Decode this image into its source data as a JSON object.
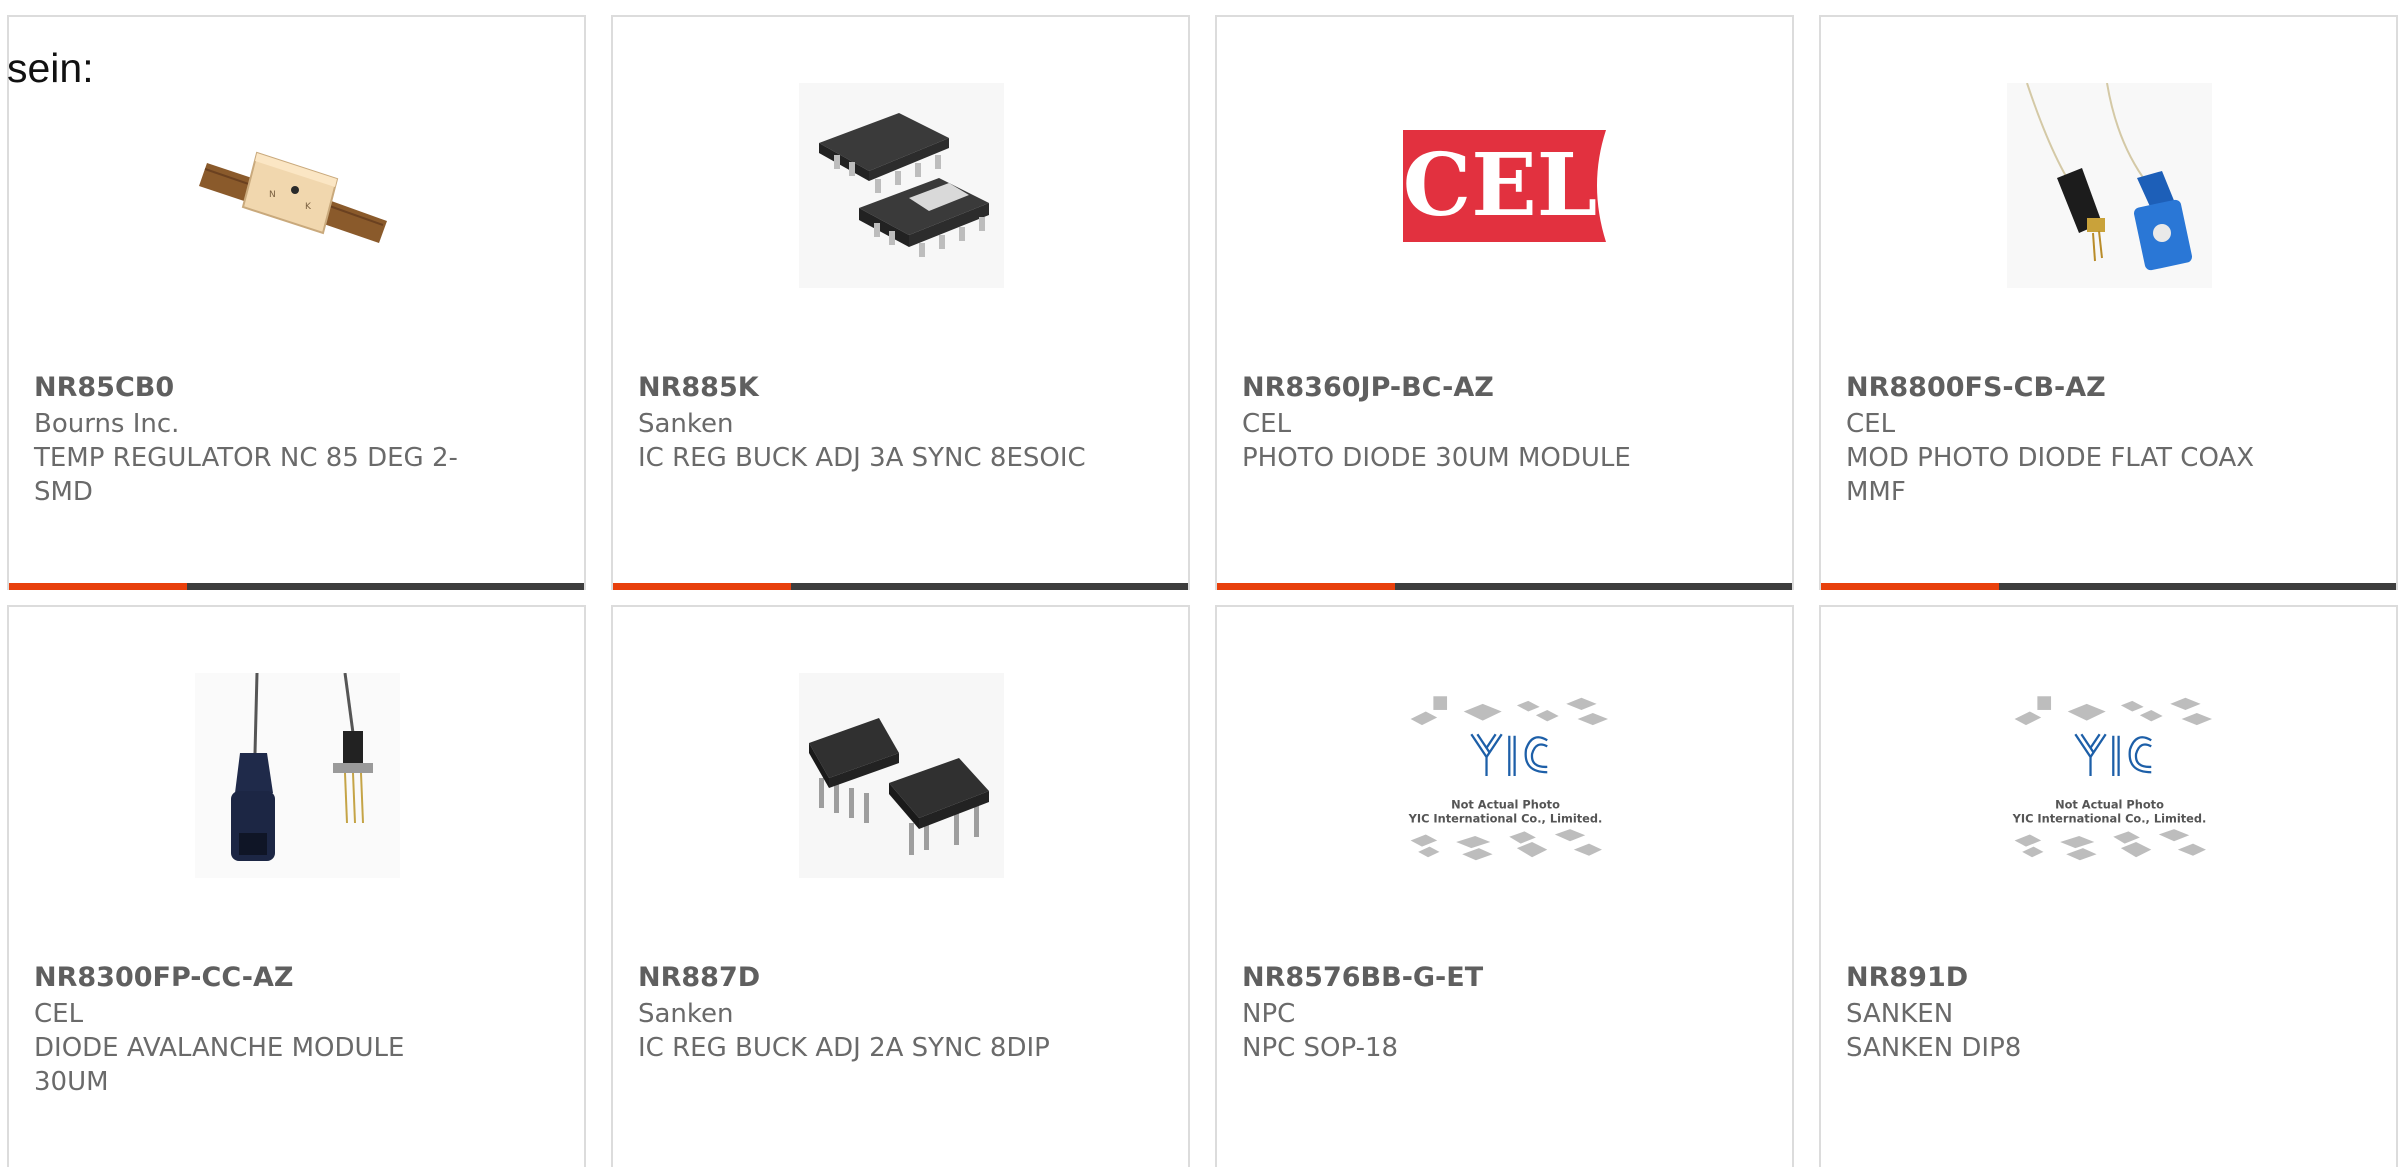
{
  "page": {
    "heading": "sein:"
  },
  "colors": {
    "accent": "#e8400c",
    "bar": "#3d3d3d",
    "card_border": "#dcdcdc",
    "text": "#5f5f5f"
  },
  "cards": [
    {
      "part_number": "NR85CB0",
      "manufacturer": "Bourns Inc.",
      "description": "TEMP REGULATOR NC 85 DEG 2-SMD",
      "image": "temp-regulator-photo",
      "progress": 0.31
    },
    {
      "part_number": "NR885K",
      "manufacturer": "Sanken",
      "description": "IC REG BUCK ADJ 3A SYNC 8ESOIC",
      "image": "soic-chip-photo",
      "progress": 0.31
    },
    {
      "part_number": "NR8360JP-BC-AZ",
      "manufacturer": "CEL",
      "description": "PHOTO DIODE 30UM MODULE",
      "image": "cel-logo",
      "logo_text": "CEL",
      "progress": 0.31
    },
    {
      "part_number": "NR8800FS-CB-AZ",
      "manufacturer": "CEL",
      "description": "MOD PHOTO DIODE FLAT COAX MMF",
      "image": "fiber-connector-photo",
      "progress": 0.31
    },
    {
      "part_number": "NR8300FP-CC-AZ",
      "manufacturer": "CEL",
      "description": "DIODE AVALANCHE MODULE 30UM",
      "image": "fiber-diode-photo"
    },
    {
      "part_number": "NR887D",
      "manufacturer": "Sanken",
      "description": "IC REG BUCK ADJ 2A SYNC 8DIP",
      "image": "dip-chip-photo"
    },
    {
      "part_number": "NR8576BB-G-ET",
      "manufacturer": "NPC",
      "description": "NPC SOP-18",
      "image": "yic-placeholder",
      "placeholder_line1": "Not Actual Photo",
      "placeholder_line2": "YIC International Co., Limited."
    },
    {
      "part_number": "NR891D",
      "manufacturer": "SANKEN",
      "description": "SANKEN DIP8",
      "image": "yic-placeholder",
      "placeholder_line1": "Not Actual Photo",
      "placeholder_line2": "YIC International Co., Limited."
    }
  ]
}
